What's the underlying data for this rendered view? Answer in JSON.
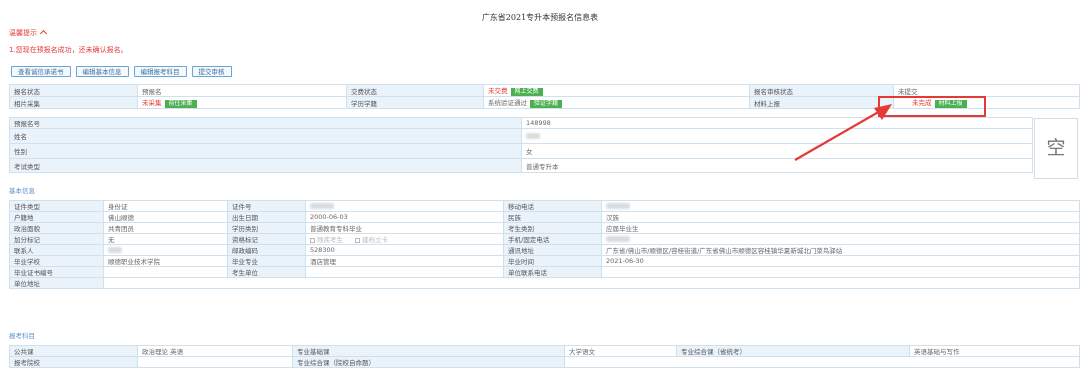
{
  "title": "广东省2021专升本预报名信息表",
  "tip": {
    "header": "温馨提示",
    "message": "1.您现在预报名成功，还未确认报名。"
  },
  "buttons": [
    "查看诚信承诺书",
    "编辑基本信息",
    "编辑报考科目",
    "提交审核"
  ],
  "status": {
    "reg_status_label": "报名状态",
    "reg_status_value": "预报名",
    "pay_status_label": "交费状态",
    "pay_status_value": "未交费",
    "pay_action": "网上交费",
    "review_status_label": "报名审核状态",
    "review_status_value": "未提交",
    "photo_label": "相片采集",
    "photo_value": "未采集",
    "photo_action": "前往采集",
    "degree_label": "学历学籍",
    "degree_value": "系统验证通过",
    "degree_action": "验证学籍",
    "material_label": "材料上报",
    "material_value": "未完成",
    "material_action": "材料上报"
  },
  "profile": {
    "prereg_label": "预报名号",
    "prereg_value": "148998",
    "name_label": "姓名",
    "gender_label": "性别",
    "gender_value": "女",
    "exam_type_label": "考试类型",
    "exam_type_value": "普通专升本",
    "photo_placeholder": "空"
  },
  "basic": {
    "section": "基本信息",
    "id_type_label": "证件类型",
    "id_type_value": "身份证",
    "id_no_label": "证件号",
    "mobile_label": "移动电话",
    "hukou_label": "户籍地",
    "hukou_value": "佛山顺德",
    "birth_label": "出生日期",
    "birth_value": "2000-06-03",
    "ethnic_label": "民族",
    "ethnic_value": "汉族",
    "political_label": "政治面貌",
    "political_value": "共青团员",
    "edu_cat_label": "学历类别",
    "edu_cat_value": "普通教育专科毕业",
    "cand_cat_label": "考生类别",
    "cand_cat_value": "应届毕业生",
    "bonus_label": "加分标记",
    "bonus_value": "无",
    "qual_label": "资格标记",
    "qual_opt1": "残疾考生",
    "qual_opt2": "建档立卡",
    "phone_label": "手机/固定电话",
    "contact_label": "联系人",
    "postcode_label": "邮政编码",
    "postcode_value": "528300",
    "address_label": "通讯地址",
    "address_value": "广东省/佛山市/顺德区/容桂街道/广东省佛山市顺德区容桂镇华夏新城北门菜鸟驿站",
    "school_label": "毕业学校",
    "school_value": "顺德职业技术学院",
    "major_label": "毕业专业",
    "major_value": "酒店管理",
    "grad_time_label": "毕业时间",
    "grad_time_value": "2021-06-30",
    "cert_label": "毕业证书编号",
    "employer_label": "考生单位",
    "employer_phone_label": "单位联系电话",
    "employer_addr_label": "单位地址"
  },
  "subjects": {
    "section": "报考科目",
    "public_label": "公共课",
    "public_value": "政治理论 英语",
    "major_base_label": "专业基础课",
    "major_base_value": "大学语文",
    "major_comp_label": "专业综合课（省统考）",
    "major_comp_value": "英语基础与写作",
    "target_label": "报考院校",
    "major_comp_school_label": "专业综合课（院校自命题）"
  },
  "colors": {
    "accent": "#5a8fcf",
    "red": "#e53935",
    "green": "#4caf50",
    "label_bg": "#eaf2fa"
  }
}
